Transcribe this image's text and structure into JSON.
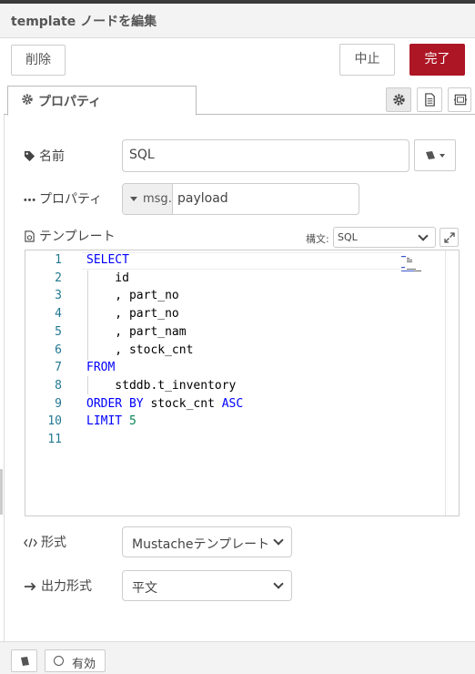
{
  "dialog": {
    "title": "template ノードを編集"
  },
  "buttons": {
    "delete": "削除",
    "cancel": "中止",
    "done": "完了"
  },
  "tabs": {
    "properties": "プロパティ"
  },
  "fields": {
    "name": {
      "label": "名前",
      "value": "SQL"
    },
    "property": {
      "label": "プロパティ",
      "type_prefix": "msg.",
      "value": "payload"
    },
    "template": {
      "label": "テンプレート",
      "syntax_label": "構文:",
      "syntax_value": "SQL"
    },
    "format": {
      "label": "形式",
      "value": "Mustacheテンプレート"
    },
    "output": {
      "label": "出力形式",
      "value": "平文"
    }
  },
  "editor": {
    "lines": [
      {
        "n": "1",
        "parts": [
          {
            "t": "kw",
            "v": "SELECT"
          }
        ]
      },
      {
        "n": "2",
        "parts": [
          {
            "t": "txt",
            "v": "    id"
          }
        ]
      },
      {
        "n": "3",
        "parts": [
          {
            "t": "txt",
            "v": "    , part_no"
          }
        ]
      },
      {
        "n": "4",
        "parts": [
          {
            "t": "txt",
            "v": "    , part_no"
          }
        ]
      },
      {
        "n": "5",
        "parts": [
          {
            "t": "txt",
            "v": "    , part_nam"
          }
        ]
      },
      {
        "n": "6",
        "parts": [
          {
            "t": "txt",
            "v": "    , stock_cnt"
          }
        ]
      },
      {
        "n": "7",
        "parts": [
          {
            "t": "kw",
            "v": "FROM"
          }
        ]
      },
      {
        "n": "8",
        "parts": [
          {
            "t": "txt",
            "v": "    stddb.t_inventory"
          }
        ]
      },
      {
        "n": "9",
        "parts": [
          {
            "t": "kw",
            "v": "ORDER BY"
          },
          {
            "t": "txt",
            "v": " stock_cnt "
          },
          {
            "t": "kw",
            "v": "ASC"
          }
        ]
      },
      {
        "n": "10",
        "parts": [
          {
            "t": "kw",
            "v": "LIMIT"
          },
          {
            "t": "txt",
            "v": " "
          },
          {
            "t": "num",
            "v": "5"
          }
        ]
      },
      {
        "n": "11",
        "parts": []
      }
    ]
  },
  "footer": {
    "enabled_label": "有効"
  },
  "colors": {
    "accent": "#ad1625",
    "keyword": "#0000ff",
    "number": "#098658",
    "line_number": "#237893"
  }
}
